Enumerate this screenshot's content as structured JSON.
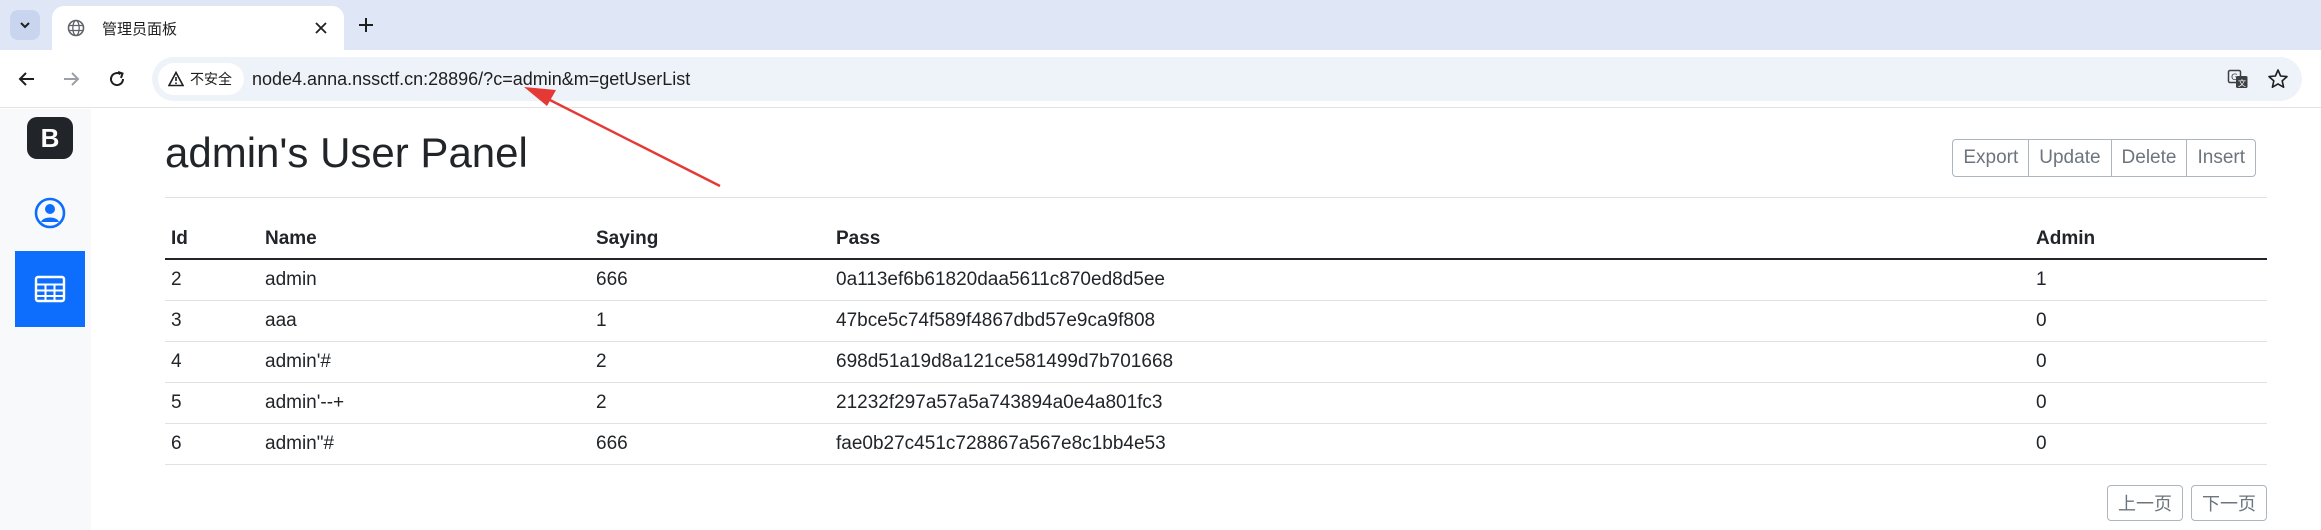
{
  "browser": {
    "tab": {
      "title": "管理员面板"
    },
    "security_label": "不安全",
    "url": "node4.anna.nssctf.cn:28896/?c=admin&m=getUserList"
  },
  "sidebar": {
    "brand_letter": "B",
    "items": [
      {
        "icon": "person-circle-icon"
      },
      {
        "icon": "table-icon",
        "active": true
      }
    ]
  },
  "panel": {
    "title": "admin's User Panel",
    "actions": [
      "Export",
      "Update",
      "Delete",
      "Insert"
    ]
  },
  "table": {
    "columns": [
      "Id",
      "Name",
      "Saying",
      "Pass",
      "Admin"
    ],
    "rows": [
      [
        "2",
        "admin",
        "666",
        "0a113ef6b61820daa5611c870ed8d5ee",
        "1"
      ],
      [
        "3",
        "aaa",
        "1",
        "47bce5c74f589f4867dbd57e9ca9f808",
        "0"
      ],
      [
        "4",
        "admin'#",
        "2",
        "698d51a19d8a121ce581499d7b701668",
        "0"
      ],
      [
        "5",
        "admin'--+",
        "2",
        "21232f297a57a5a743894a0e4a801fc3",
        "0"
      ],
      [
        "6",
        "admin\"#",
        "666",
        "fae0b27c451c728867a567e8c1bb4e53",
        "0"
      ]
    ]
  },
  "pager": {
    "prev": "上一页",
    "next": "下一页"
  },
  "colors": {
    "accent": "#0d6efd",
    "annotation": "#e53935",
    "tabstrip": "#dfe7f7"
  }
}
